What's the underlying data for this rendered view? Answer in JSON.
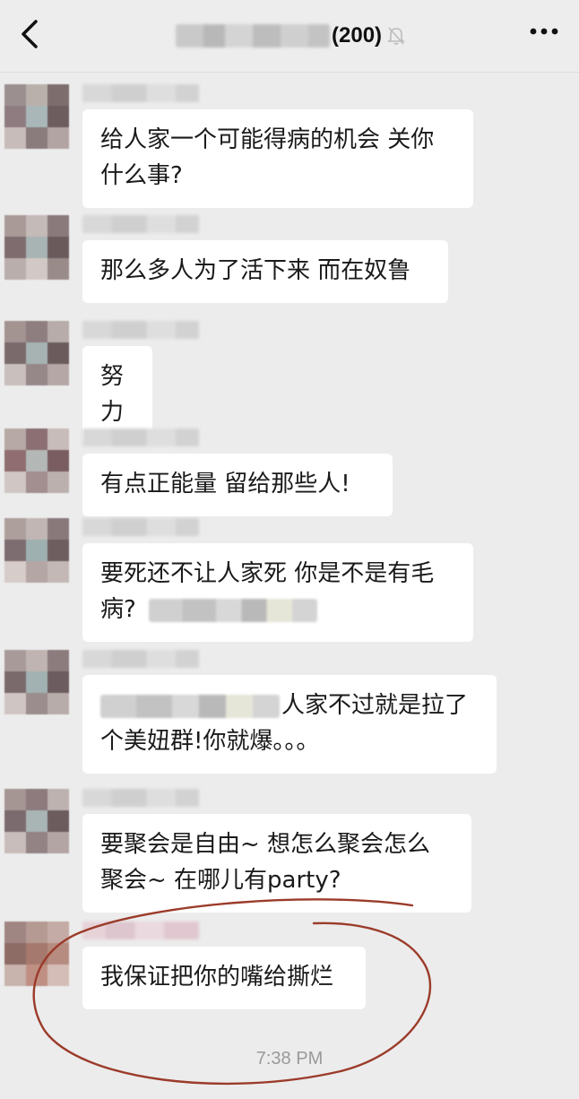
{
  "header": {
    "member_count": "(200)",
    "icons": [
      "back-icon",
      "mute-icon",
      "more-icon"
    ]
  },
  "messages": [
    {
      "lines": [
        "给人家一个可能得病的机会 关你",
        "什么事?"
      ]
    },
    {
      "lines": [
        "那么多人为了活下来 而在奴鲁"
      ]
    },
    {
      "lines": [
        "努力"
      ]
    },
    {
      "lines": [
        "有点正能量 留给那些人!"
      ]
    },
    {
      "lines": [
        "要死还不让人家死 你是不是有毛",
        "病?"
      ]
    },
    {
      "lines": [
        "人家不过就是拉了",
        "个美妞群!你就爆。。。"
      ]
    },
    {
      "lines": [
        "要聚会是自由~ 想怎么聚会怎么",
        "聚会~ 在哪儿有party?"
      ]
    },
    {
      "lines": [
        "我保证把你的嘴给撕烂"
      ]
    }
  ],
  "timestamp": "7:38 PM",
  "colors": {
    "background": "#ececec",
    "bubble": "#ffffff",
    "annotation": "#9b3b2a"
  }
}
